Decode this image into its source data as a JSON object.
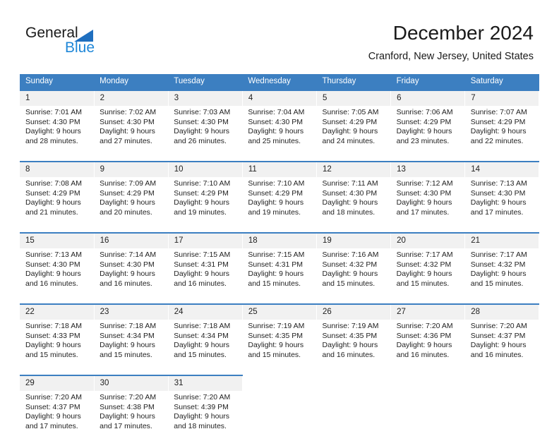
{
  "brand": {
    "name_part1": "General",
    "name_part2": "Blue",
    "triangle_icon": "triangle-icon",
    "accent_color": "#1f87d8",
    "header_color": "#3c7fc1"
  },
  "header": {
    "title": "December 2024",
    "subtitle": "Cranford, New Jersey, United States"
  },
  "weekdays": [
    "Sunday",
    "Monday",
    "Tuesday",
    "Wednesday",
    "Thursday",
    "Friday",
    "Saturday"
  ],
  "weeks": [
    {
      "days": [
        {
          "date": "1",
          "sunrise": "Sunrise: 7:01 AM",
          "sunset": "Sunset: 4:30 PM",
          "daylight1": "Daylight: 9 hours",
          "daylight2": "and 28 minutes."
        },
        {
          "date": "2",
          "sunrise": "Sunrise: 7:02 AM",
          "sunset": "Sunset: 4:30 PM",
          "daylight1": "Daylight: 9 hours",
          "daylight2": "and 27 minutes."
        },
        {
          "date": "3",
          "sunrise": "Sunrise: 7:03 AM",
          "sunset": "Sunset: 4:30 PM",
          "daylight1": "Daylight: 9 hours",
          "daylight2": "and 26 minutes."
        },
        {
          "date": "4",
          "sunrise": "Sunrise: 7:04 AM",
          "sunset": "Sunset: 4:30 PM",
          "daylight1": "Daylight: 9 hours",
          "daylight2": "and 25 minutes."
        },
        {
          "date": "5",
          "sunrise": "Sunrise: 7:05 AM",
          "sunset": "Sunset: 4:29 PM",
          "daylight1": "Daylight: 9 hours",
          "daylight2": "and 24 minutes."
        },
        {
          "date": "6",
          "sunrise": "Sunrise: 7:06 AM",
          "sunset": "Sunset: 4:29 PM",
          "daylight1": "Daylight: 9 hours",
          "daylight2": "and 23 minutes."
        },
        {
          "date": "7",
          "sunrise": "Sunrise: 7:07 AM",
          "sunset": "Sunset: 4:29 PM",
          "daylight1": "Daylight: 9 hours",
          "daylight2": "and 22 minutes."
        }
      ]
    },
    {
      "days": [
        {
          "date": "8",
          "sunrise": "Sunrise: 7:08 AM",
          "sunset": "Sunset: 4:29 PM",
          "daylight1": "Daylight: 9 hours",
          "daylight2": "and 21 minutes."
        },
        {
          "date": "9",
          "sunrise": "Sunrise: 7:09 AM",
          "sunset": "Sunset: 4:29 PM",
          "daylight1": "Daylight: 9 hours",
          "daylight2": "and 20 minutes."
        },
        {
          "date": "10",
          "sunrise": "Sunrise: 7:10 AM",
          "sunset": "Sunset: 4:29 PM",
          "daylight1": "Daylight: 9 hours",
          "daylight2": "and 19 minutes."
        },
        {
          "date": "11",
          "sunrise": "Sunrise: 7:10 AM",
          "sunset": "Sunset: 4:29 PM",
          "daylight1": "Daylight: 9 hours",
          "daylight2": "and 19 minutes."
        },
        {
          "date": "12",
          "sunrise": "Sunrise: 7:11 AM",
          "sunset": "Sunset: 4:30 PM",
          "daylight1": "Daylight: 9 hours",
          "daylight2": "and 18 minutes."
        },
        {
          "date": "13",
          "sunrise": "Sunrise: 7:12 AM",
          "sunset": "Sunset: 4:30 PM",
          "daylight1": "Daylight: 9 hours",
          "daylight2": "and 17 minutes."
        },
        {
          "date": "14",
          "sunrise": "Sunrise: 7:13 AM",
          "sunset": "Sunset: 4:30 PM",
          "daylight1": "Daylight: 9 hours",
          "daylight2": "and 17 minutes."
        }
      ]
    },
    {
      "days": [
        {
          "date": "15",
          "sunrise": "Sunrise: 7:13 AM",
          "sunset": "Sunset: 4:30 PM",
          "daylight1": "Daylight: 9 hours",
          "daylight2": "and 16 minutes."
        },
        {
          "date": "16",
          "sunrise": "Sunrise: 7:14 AM",
          "sunset": "Sunset: 4:30 PM",
          "daylight1": "Daylight: 9 hours",
          "daylight2": "and 16 minutes."
        },
        {
          "date": "17",
          "sunrise": "Sunrise: 7:15 AM",
          "sunset": "Sunset: 4:31 PM",
          "daylight1": "Daylight: 9 hours",
          "daylight2": "and 16 minutes."
        },
        {
          "date": "18",
          "sunrise": "Sunrise: 7:15 AM",
          "sunset": "Sunset: 4:31 PM",
          "daylight1": "Daylight: 9 hours",
          "daylight2": "and 15 minutes."
        },
        {
          "date": "19",
          "sunrise": "Sunrise: 7:16 AM",
          "sunset": "Sunset: 4:32 PM",
          "daylight1": "Daylight: 9 hours",
          "daylight2": "and 15 minutes."
        },
        {
          "date": "20",
          "sunrise": "Sunrise: 7:17 AM",
          "sunset": "Sunset: 4:32 PM",
          "daylight1": "Daylight: 9 hours",
          "daylight2": "and 15 minutes."
        },
        {
          "date": "21",
          "sunrise": "Sunrise: 7:17 AM",
          "sunset": "Sunset: 4:32 PM",
          "daylight1": "Daylight: 9 hours",
          "daylight2": "and 15 minutes."
        }
      ]
    },
    {
      "days": [
        {
          "date": "22",
          "sunrise": "Sunrise: 7:18 AM",
          "sunset": "Sunset: 4:33 PM",
          "daylight1": "Daylight: 9 hours",
          "daylight2": "and 15 minutes."
        },
        {
          "date": "23",
          "sunrise": "Sunrise: 7:18 AM",
          "sunset": "Sunset: 4:34 PM",
          "daylight1": "Daylight: 9 hours",
          "daylight2": "and 15 minutes."
        },
        {
          "date": "24",
          "sunrise": "Sunrise: 7:18 AM",
          "sunset": "Sunset: 4:34 PM",
          "daylight1": "Daylight: 9 hours",
          "daylight2": "and 15 minutes."
        },
        {
          "date": "25",
          "sunrise": "Sunrise: 7:19 AM",
          "sunset": "Sunset: 4:35 PM",
          "daylight1": "Daylight: 9 hours",
          "daylight2": "and 15 minutes."
        },
        {
          "date": "26",
          "sunrise": "Sunrise: 7:19 AM",
          "sunset": "Sunset: 4:35 PM",
          "daylight1": "Daylight: 9 hours",
          "daylight2": "and 16 minutes."
        },
        {
          "date": "27",
          "sunrise": "Sunrise: 7:20 AM",
          "sunset": "Sunset: 4:36 PM",
          "daylight1": "Daylight: 9 hours",
          "daylight2": "and 16 minutes."
        },
        {
          "date": "28",
          "sunrise": "Sunrise: 7:20 AM",
          "sunset": "Sunset: 4:37 PM",
          "daylight1": "Daylight: 9 hours",
          "daylight2": "and 16 minutes."
        }
      ]
    },
    {
      "days": [
        {
          "date": "29",
          "sunrise": "Sunrise: 7:20 AM",
          "sunset": "Sunset: 4:37 PM",
          "daylight1": "Daylight: 9 hours",
          "daylight2": "and 17 minutes."
        },
        {
          "date": "30",
          "sunrise": "Sunrise: 7:20 AM",
          "sunset": "Sunset: 4:38 PM",
          "daylight1": "Daylight: 9 hours",
          "daylight2": "and 17 minutes."
        },
        {
          "date": "31",
          "sunrise": "Sunrise: 7:20 AM",
          "sunset": "Sunset: 4:39 PM",
          "daylight1": "Daylight: 9 hours",
          "daylight2": "and 18 minutes."
        },
        {
          "date": "",
          "sunrise": "",
          "sunset": "",
          "daylight1": "",
          "daylight2": ""
        },
        {
          "date": "",
          "sunrise": "",
          "sunset": "",
          "daylight1": "",
          "daylight2": ""
        },
        {
          "date": "",
          "sunrise": "",
          "sunset": "",
          "daylight1": "",
          "daylight2": ""
        },
        {
          "date": "",
          "sunrise": "",
          "sunset": "",
          "daylight1": "",
          "daylight2": ""
        }
      ]
    }
  ]
}
